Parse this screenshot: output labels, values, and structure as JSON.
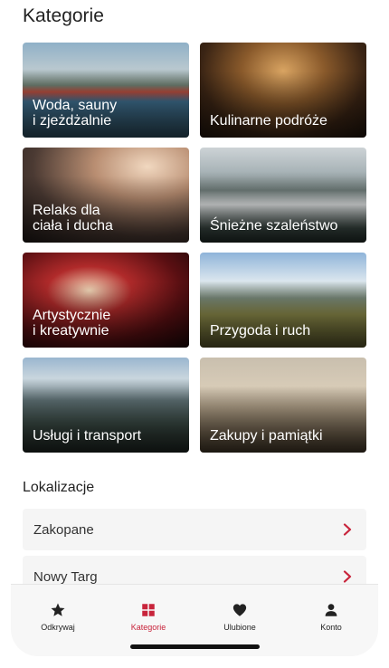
{
  "header": {
    "title": "Kategorie"
  },
  "categories": [
    {
      "label": "Woda, sauny\ni zjeżdżalnie",
      "image": "water-park-image"
    },
    {
      "label": "Kulinarne podróże",
      "image": "restaurant-image"
    },
    {
      "label": "Relaks dla\nciała i ducha",
      "image": "spa-image"
    },
    {
      "label": "Śnieżne szaleństwo",
      "image": "snow-mountains-image"
    },
    {
      "label": "Artystycznie\ni kreatywnie",
      "image": "theatre-stage-image"
    },
    {
      "label": "Przygoda i ruch",
      "image": "hiking-image"
    },
    {
      "label": "Usługi i transport",
      "image": "van-mountains-image"
    },
    {
      "label": "Zakupy i pamiątki",
      "image": "souvenir-shop-image"
    }
  ],
  "locations": {
    "title": "Lokalizacje",
    "items": [
      {
        "label": "Zakopane"
      },
      {
        "label": "Nowy Targ"
      }
    ]
  },
  "tabbar": {
    "tabs": [
      {
        "label": "Odkrywaj",
        "icon": "star-icon"
      },
      {
        "label": "Kategorie",
        "icon": "grid-icon"
      },
      {
        "label": "Ulubione",
        "icon": "heart-icon"
      },
      {
        "label": "Konto",
        "icon": "person-icon"
      }
    ],
    "active": "Kategorie"
  },
  "colors": {
    "accent": "#c8243b",
    "tab_icon": "#222222",
    "row_bg": "#f5f5f5"
  }
}
